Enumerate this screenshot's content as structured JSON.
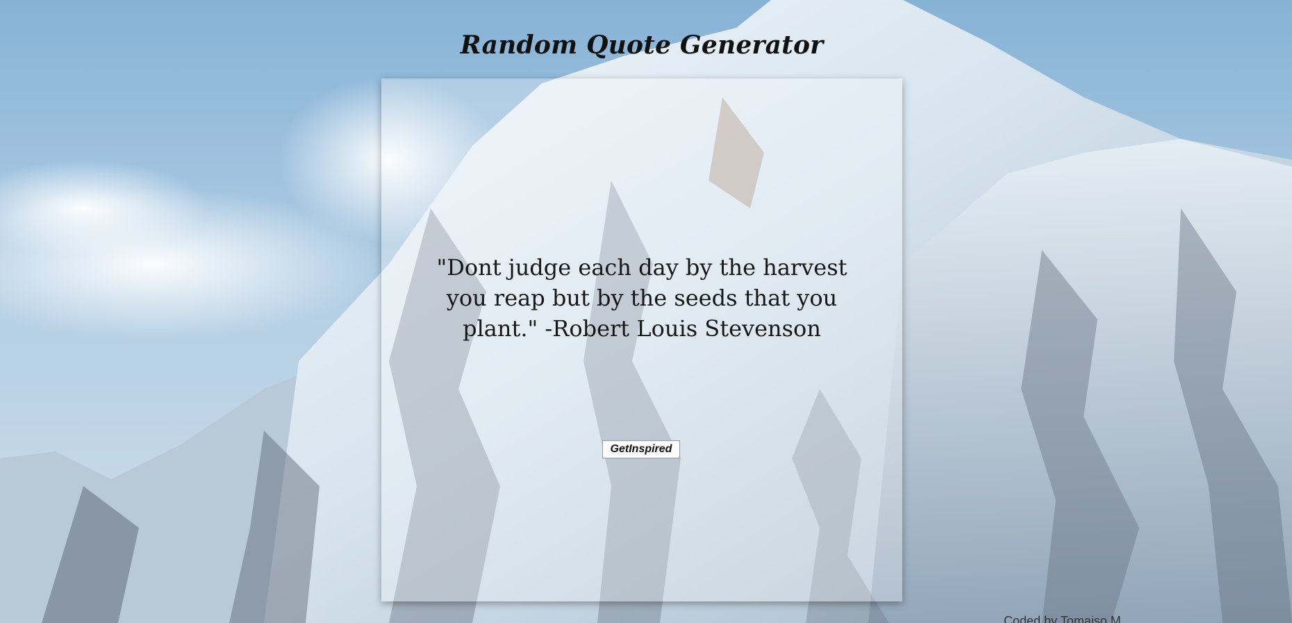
{
  "page": {
    "title": "Random Quote Generator",
    "quote": "\"Dont judge each day by the harvest you reap but by the seeds that you plant.\" -Robert Louis Stevenson",
    "button_label": "GetInspired",
    "footer": "Coded by Tomaiso M..."
  },
  "colors": {
    "sky": "#9cc0de",
    "snow": "#e8f0f6",
    "rock": "#5a6472",
    "card_overlay": "rgba(255,255,255,0.28)"
  }
}
